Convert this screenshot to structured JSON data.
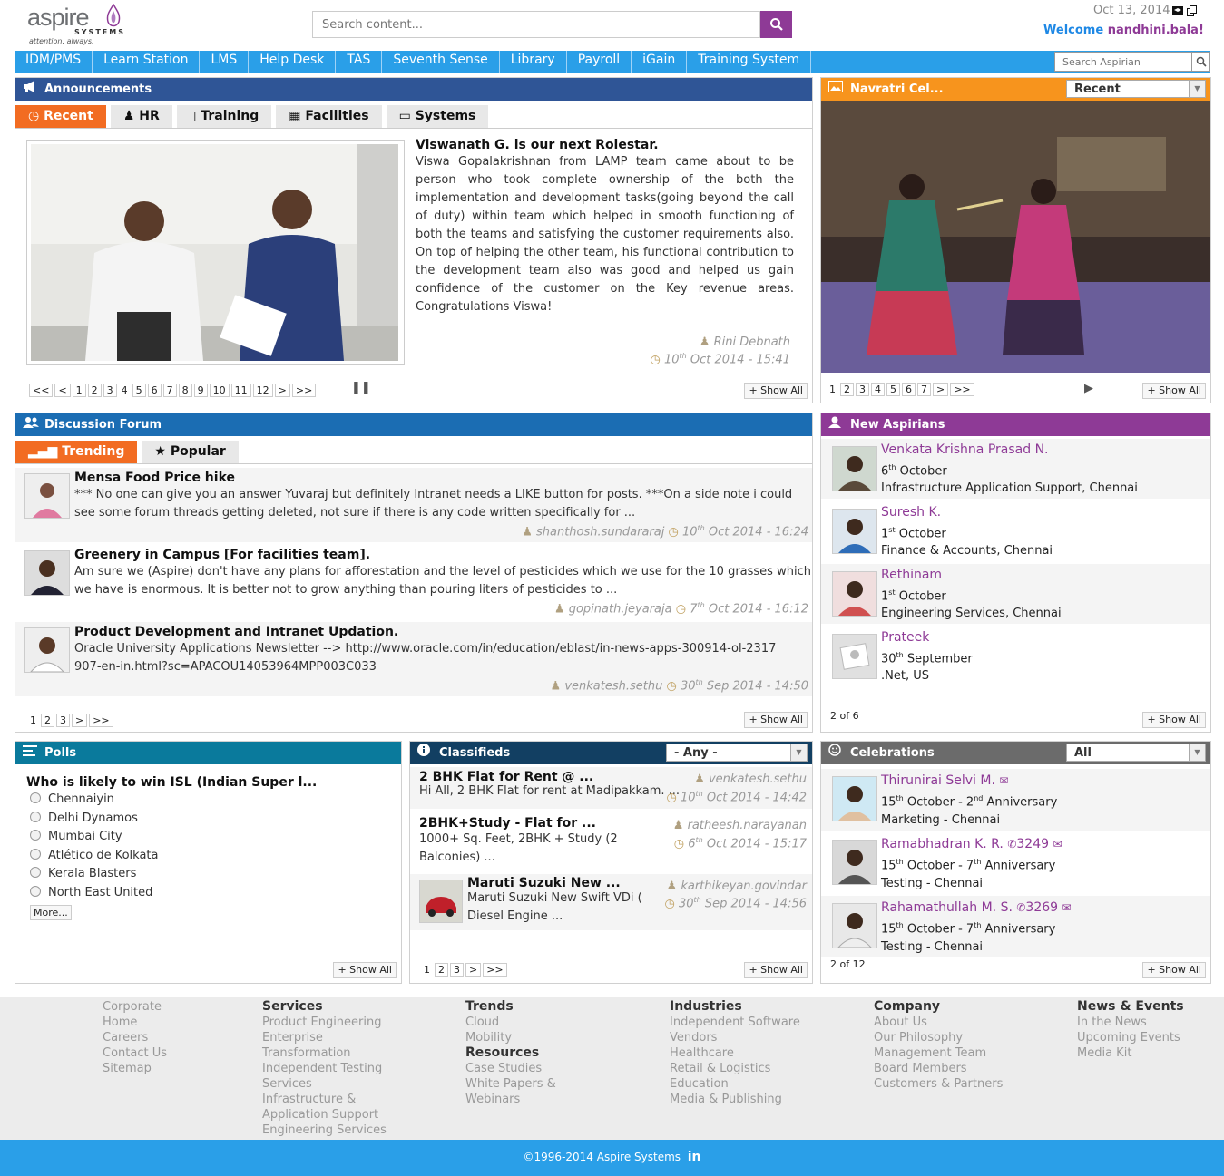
{
  "header": {
    "logo_word": "aspire",
    "logo_sub": "SYSTEMS",
    "logo_tagline": "attention. always.",
    "search_placeholder": "Search content...",
    "date": "Oct 13, 2014",
    "welcome_prefix": "Welcome",
    "username": "nandhini.bala!"
  },
  "nav": {
    "items": [
      "IDM/PMS",
      "Learn Station",
      "LMS",
      "Help Desk",
      "TAS",
      "Seventh Sense",
      "Library",
      "Payroll",
      "iGain",
      "Training System"
    ],
    "search_placeholder": "Search Aspirian"
  },
  "announcements": {
    "title": "Announcements",
    "tabs": [
      "Recent",
      "HR",
      "Training",
      "Facilities",
      "Systems"
    ],
    "post_title": "Viswanath G. is our next Rolestar.",
    "post_body": "Viswa Gopalakrishnan from LAMP team came about to be person who took complete ownership of the both the implementation and development tasks(going beyond the call of duty) within team which helped in smooth functioning of both the teams and satisfying the customer requirements also. On top of helping the other team, his functional contribution to the development team also was good and helped us gain confidence of the customer on the Key revenue areas. Congratulations Viswa!",
    "author": "Rini Debnath",
    "date_day": "10",
    "date_sup": "th",
    "date_rest": "Oct 2014 - 15:41",
    "pages": [
      "<<",
      "<",
      "1",
      "2",
      "3",
      "4",
      "5",
      "6",
      "7",
      "8",
      "9",
      "10",
      "11",
      "12",
      ">",
      ">>"
    ],
    "show_all": "Show All"
  },
  "gallery": {
    "title": "Navratri Cel...",
    "dropdown": "Recent",
    "pages": [
      "1",
      "2",
      "3",
      "4",
      "5",
      "6",
      "7",
      ">",
      ">>"
    ],
    "show_all": "Show All"
  },
  "forum": {
    "title": "Discussion Forum",
    "tabs": [
      "Trending",
      "Popular"
    ],
    "posts": [
      {
        "title": "Mensa Food Price hike",
        "body": "*** No one can give you an answer Yuvaraj but definitely Intranet needs a LIKE button for posts. ***On a side note i could see some forum threads getting deleted, not sure if there is any code written specifically for ...",
        "author": "shanthosh.sundararaj",
        "day": "10",
        "sup": "th",
        "rest": "Oct 2014 - 16:24"
      },
      {
        "title": "Greenery in Campus [For facilities team].",
        "body": "Am sure we (Aspire) don't have any plans for afforestation and the level of pesticides which we use for the 10 grasses which we have is enormous. It is better not to grow anything than pouring liters of pesticides to ...",
        "author": "gopinath.jeyaraja",
        "day": "7",
        "sup": "th",
        "rest": "Oct 2014 - 16:12"
      },
      {
        "title": "Product Development and Intranet Updation.",
        "body": "Oracle University Applications Newsletter --> http://www.oracle.com/in/education/eblast/in-news-apps-300914-ol-2317907-en-in.html?sc=APACOU14053964MPP003C033",
        "author": "venkatesh.sethu",
        "day": "30",
        "sup": "th",
        "rest": "Sep 2014 - 14:50"
      }
    ],
    "pages": [
      "1",
      "2",
      "3",
      ">",
      ">>"
    ],
    "show_all": "Show All"
  },
  "aspirians": {
    "title": "New Aspirians",
    "people": [
      {
        "name": "Venkata Krishna Prasad N.",
        "day": "6",
        "sup": "th",
        "month": "October",
        "dept": "Infrastructure Application Support, Chennai"
      },
      {
        "name": "Suresh K.",
        "day": "1",
        "sup": "st",
        "month": "October",
        "dept": "Finance & Accounts, Chennai"
      },
      {
        "name": "Rethinam",
        "day": "1",
        "sup": "st",
        "month": "October",
        "dept": "Engineering Services, Chennai"
      },
      {
        "name": "Prateek",
        "day": "30",
        "sup": "th",
        "month": "September",
        "dept": ".Net, US"
      }
    ],
    "count": "2 of 6",
    "show_all": "Show All"
  },
  "polls": {
    "title": "Polls",
    "question": "Who is likely to win ISL (Indian Super l...",
    "options": [
      "Chennaiyin",
      "Delhi Dynamos",
      "Mumbai City",
      "Atlético de Kolkata",
      "Kerala Blasters",
      "North East United"
    ],
    "more": "More...",
    "show_all": "Show All"
  },
  "classifieds": {
    "title": "Classifieds",
    "dropdown": "- Any -",
    "items": [
      {
        "title": "2 BHK Flat for Rent @ ...",
        "body": "Hi All, 2 BHK Flat for rent at Madipakkam. ...",
        "author": "venkatesh.sethu",
        "day": "10",
        "sup": "th",
        "rest": "Oct 2014 - 14:42"
      },
      {
        "title": "2BHK+Study - Flat for ...",
        "body": "1000+ Sq. Feet, 2BHK + Study (2 Balconies) ...",
        "author": "ratheesh.narayanan",
        "day": "6",
        "sup": "th",
        "rest": "Oct 2014 - 15:17"
      },
      {
        "title": "Maruti Suzuki New ...",
        "body": "Maruti Suzuki New Swift VDi ( Diesel Engine ...",
        "author": "karthikeyan.govindar",
        "day": "30",
        "sup": "th",
        "rest": "Sep 2014 - 14:56"
      }
    ],
    "pages": [
      "1",
      "2",
      "3",
      ">",
      ">>"
    ],
    "show_all": "Show All"
  },
  "celebrations": {
    "title": "Celebrations",
    "dropdown": "All",
    "people": [
      {
        "name": "Thirunirai Selvi M.",
        "ext": "",
        "day": "15",
        "sup": "th",
        "month": "October",
        "n": "2",
        "nsup": "nd",
        "label": "Anniversary",
        "dept": "Marketing - Chennai"
      },
      {
        "name": "Ramabhadran K. R.",
        "ext": "3249",
        "day": "15",
        "sup": "th",
        "month": "October",
        "n": "7",
        "nsup": "th",
        "label": "Anniversary",
        "dept": "Testing - Chennai"
      },
      {
        "name": "Rahamathullah M. S.",
        "ext": "3269",
        "day": "15",
        "sup": "th",
        "month": "October",
        "n": "7",
        "nsup": "th",
        "label": "Anniversary",
        "dept": "Testing - Chennai"
      }
    ],
    "count": "2 of 12",
    "show_all": "Show All"
  },
  "footer": {
    "cols": [
      {
        "head": "",
        "items": [
          "Corporate",
          "Home",
          "Careers",
          "Contact Us",
          "Sitemap"
        ]
      },
      {
        "head": "Services",
        "items": [
          "Product Engineering",
          "Enterprise",
          "Transformation",
          "Independent Testing",
          "Services",
          "Infrastructure &",
          "Application Support",
          "Engineering Services"
        ]
      },
      {
        "head": "Trends",
        "items": [
          "Cloud",
          "Mobility"
        ],
        "head2": "Resources",
        "items2": [
          "Case Studies",
          "White Papers &",
          "Webinars"
        ]
      },
      {
        "head": "Industries",
        "items": [
          "Independent Software",
          "Vendors",
          "Healthcare",
          "Retail & Logistics",
          "Education",
          "Media & Publishing"
        ]
      },
      {
        "head": "Company",
        "items": [
          "About Us",
          "Our Philosophy",
          "Management Team",
          "Board Members",
          "Customers & Partners"
        ]
      },
      {
        "head": "News & Events",
        "items": [
          "In the News",
          "Upcoming Events",
          "Media Kit"
        ]
      }
    ],
    "copyright": "©1996-2014 Aspire Systems",
    "social": "in"
  },
  "colors": {
    "nav": "#2a9fe8",
    "announcements": "#2f5596",
    "gallery": "#f7941d",
    "forum": "#1b6db3",
    "aspirians": "#8e3a96",
    "polls": "#0a7a9c",
    "classifieds": "#123f62",
    "celebrations": "#6b6b6b",
    "accent": "#8e3a96"
  }
}
